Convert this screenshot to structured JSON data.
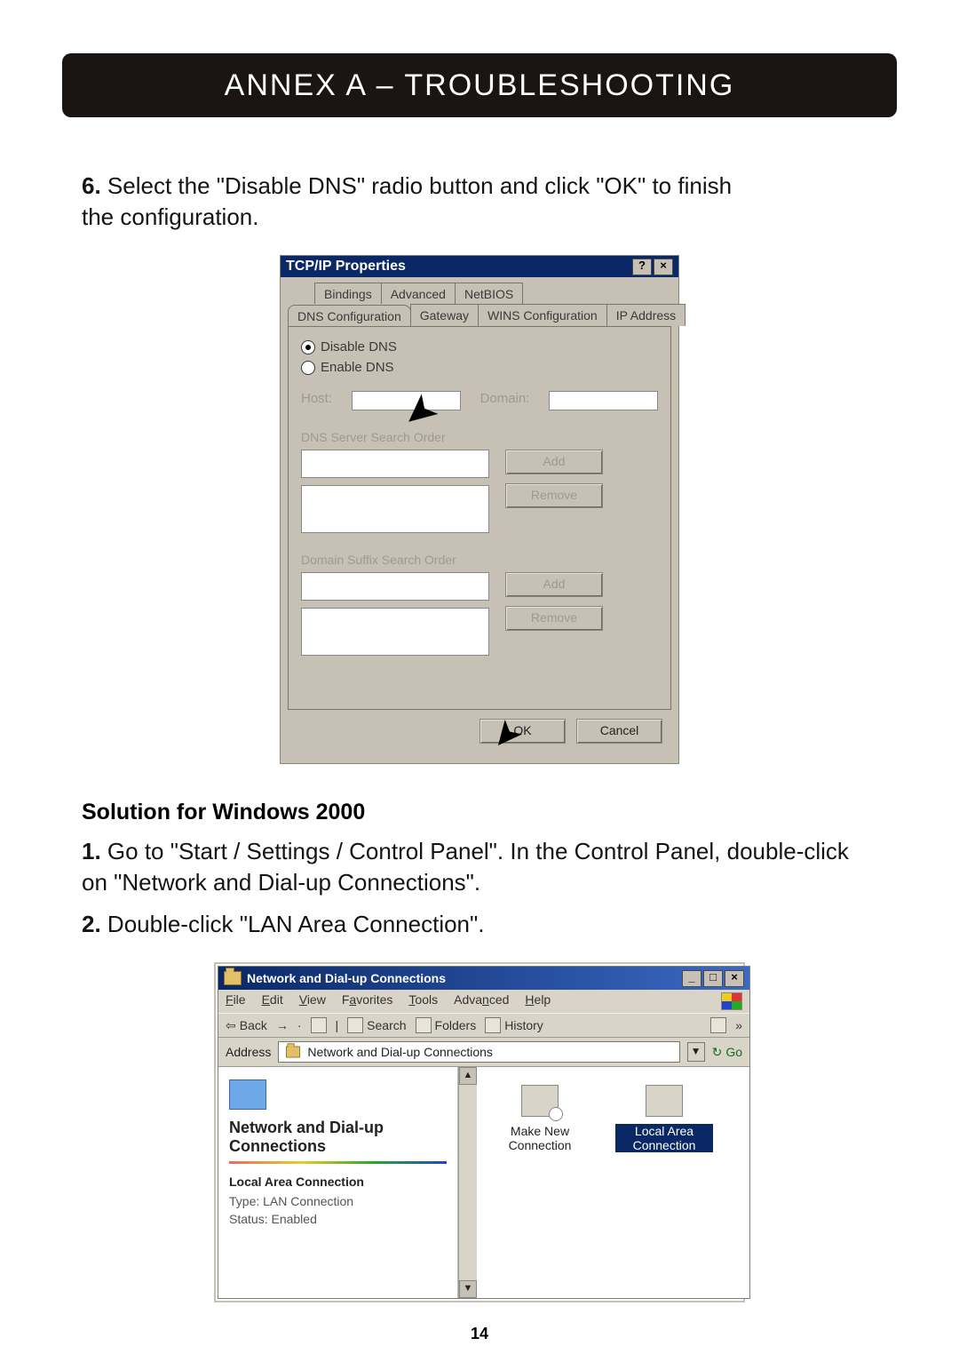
{
  "header": {
    "title": "ANNEX A – TROUBLESHOOTING"
  },
  "page_number": "14",
  "step6": {
    "num": "6.",
    "text_a": " Select the \"Disable DNS\" radio button and click \"OK\" to finish",
    "text_b": "the configuration."
  },
  "fig1": {
    "title": "TCP/IP Properties",
    "titlebar_help": "?",
    "titlebar_close": "×",
    "tabs_row1": {
      "bindings": "Bindings",
      "advanced": "Advanced",
      "netbios": "NetBIOS"
    },
    "tabs_row2": {
      "dns": "DNS Configuration",
      "gateway": "Gateway",
      "wins": "WINS Configuration",
      "ip": "IP Address"
    },
    "radio_disable": "Disable DNS",
    "radio_enable": "Enable DNS",
    "host_label": "Host:",
    "domain_label": "Domain:",
    "dns_order_label": "DNS Server Search Order",
    "suffix_order_label": "Domain Suffix Search Order",
    "btn_add": "Add",
    "btn_remove": "Remove",
    "btn_add2": "Add",
    "btn_remove2": "Remove",
    "ok": "OK",
    "cancel": "Cancel"
  },
  "subtitle": "Solution for Windows 2000",
  "step1": {
    "num": "1.",
    "text_a": " Go to \"Start / Settings / Control Panel\". In the Control Panel, double-click",
    "text_b": "on \"Network and Dial-up Connections\"."
  },
  "step2": {
    "num": "2.",
    "text": " Double-click \"LAN Area Connection\"."
  },
  "fig2": {
    "title": "Network and Dial-up Connections",
    "titlebar_min": "_",
    "titlebar_max": "□",
    "titlebar_close": "×",
    "menu": {
      "file": "File",
      "edit": "Edit",
      "view": "View",
      "favorites": "Favorites",
      "tools": "Tools",
      "advanced": "Advanced",
      "help": "Help"
    },
    "toolbar": {
      "back": "Back",
      "search": "Search",
      "folders": "Folders",
      "history": "History"
    },
    "address_label": "Address",
    "address_value": "Network and Dial-up Connections",
    "go": "Go",
    "left": {
      "heading": "Network and Dial-up Connections",
      "section": "Local Area Connection",
      "type_label": "Type:",
      "type_value": "LAN Connection",
      "status_label": "Status:",
      "status_value": "Enabled"
    },
    "items": {
      "make_new": "Make New Connection",
      "lac": "Local Area Connection"
    },
    "scroll_up": "▲",
    "scroll_down": "▼",
    "dropdown": "▼"
  }
}
